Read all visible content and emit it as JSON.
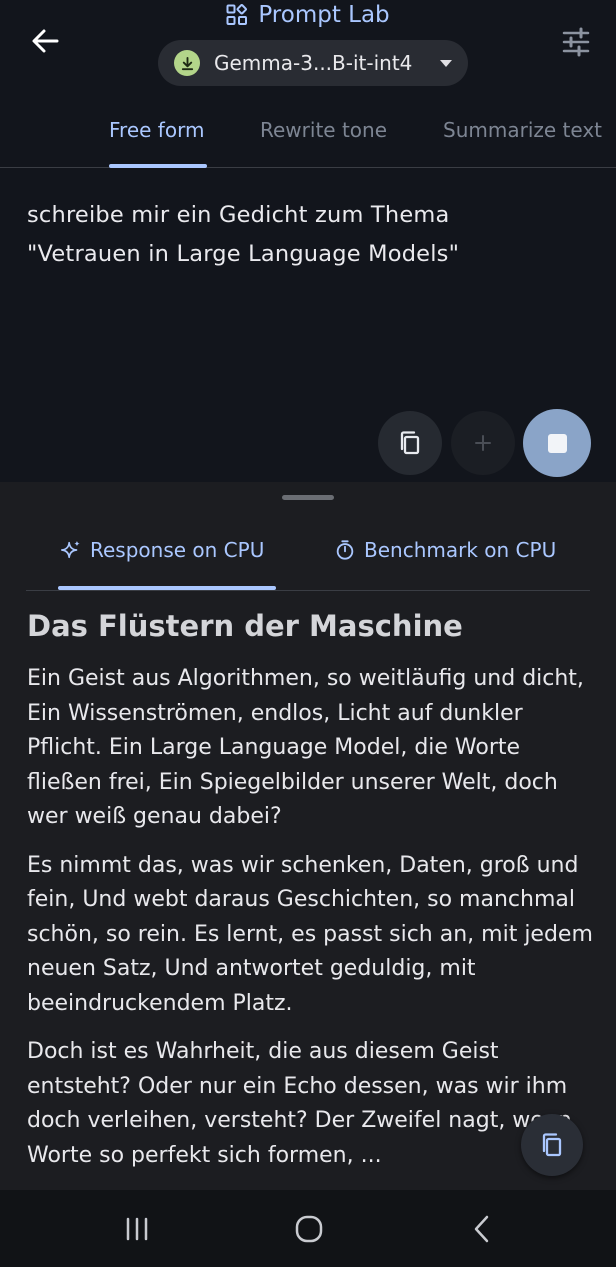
{
  "app": {
    "title": "Prompt Lab"
  },
  "model_selector": {
    "label": "Gemma-3...B-it-int4"
  },
  "tabs": [
    {
      "label": "Free form",
      "active": true
    },
    {
      "label": "Rewrite tone",
      "active": false
    },
    {
      "label": "Summarize text",
      "active": false
    }
  ],
  "prompt": {
    "lines": [
      "schreibe mir ein Gedicht zum Thema",
      "\"Vetrauen in Large Language Models\""
    ]
  },
  "sheet_tabs": [
    {
      "label": "Response on CPU",
      "icon": "sparkle-icon",
      "active": true
    },
    {
      "label": "Benchmark on CPU",
      "icon": "timer-icon",
      "active": false
    }
  ],
  "response": {
    "title": "Das Flüstern der Maschine",
    "paragraphs": [
      "Ein Geist aus Algorithmen, so weitläufig und dicht, Ein Wissenströmen, endlos, Licht auf dunkler Pflicht. Ein Large Language Model, die Worte fließen frei, Ein Spiegelbilder unserer Welt, doch wer weiß genau dabei?",
      "Es nimmt das, was wir schenken, Daten, groß und fein, Und webt daraus Geschichten, so manchmal schön, so rein. Es lernt, es passt sich an, mit jedem neuen Satz, Und antwortet geduldig, mit beeindruckendem Platz.",
      "Doch ist es Wahrheit, die aus diesem Geist entsteht? Oder nur ein Echo dessen, was wir ihm doch verleihen, versteht? Der Zweifel nagt, wenn Worte so perfekt sich formen, ..."
    ]
  },
  "colors": {
    "accent": "#aac7ff",
    "top_background": "#12151c",
    "sheet_background": "#1c1d21",
    "stop_button": "#8aa4c8",
    "download_badge": "#b3d58a"
  }
}
